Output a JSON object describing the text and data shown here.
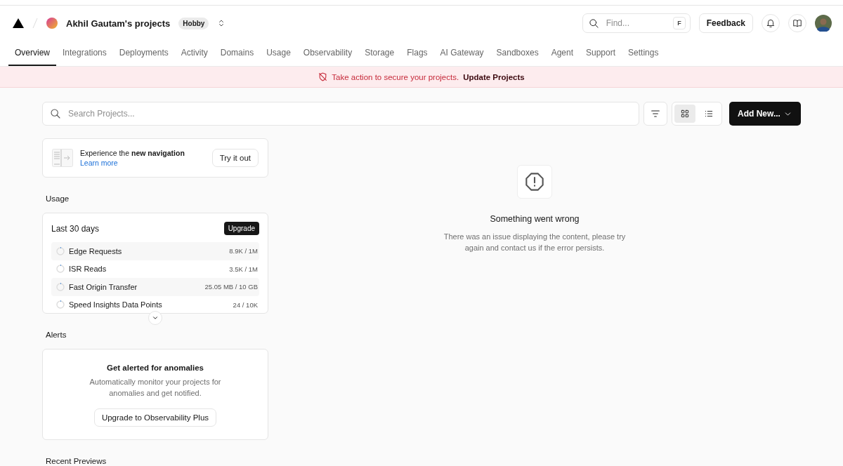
{
  "header": {
    "team": "Akhil Gautam's projects",
    "plan": "Hobby",
    "find_placeholder": "Find...",
    "find_key": "F",
    "feedback": "Feedback"
  },
  "tabs": [
    {
      "label": "Overview",
      "selected": true
    },
    {
      "label": "Integrations",
      "selected": false
    },
    {
      "label": "Deployments",
      "selected": false
    },
    {
      "label": "Activity",
      "selected": false
    },
    {
      "label": "Domains",
      "selected": false
    },
    {
      "label": "Usage",
      "selected": false
    },
    {
      "label": "Observability",
      "selected": false
    },
    {
      "label": "Storage",
      "selected": false
    },
    {
      "label": "Flags",
      "selected": false
    },
    {
      "label": "AI Gateway",
      "selected": false
    },
    {
      "label": "Sandboxes",
      "selected": false
    },
    {
      "label": "Agent",
      "selected": false
    },
    {
      "label": "Support",
      "selected": false
    },
    {
      "label": "Settings",
      "selected": false
    }
  ],
  "banner": {
    "message": "Take action to secure your projects.",
    "link": "Update Projects"
  },
  "toolbar": {
    "search_placeholder": "Search Projects...",
    "views": [
      {
        "kind": "grid",
        "selected": true
      },
      {
        "kind": "list",
        "selected": false
      }
    ],
    "add_new": "Add New..."
  },
  "nav_card": {
    "text": "Experience the **new navigation**",
    "link": "Learn more",
    "button": "Try it out"
  },
  "usage": {
    "title": "Usage",
    "period": "Last 30 days",
    "upgrade": "Upgrade",
    "items": [
      {
        "name": "Edge Requests",
        "value": "8.9K / 1M"
      },
      {
        "name": "ISR Reads",
        "value": "3.5K / 1M"
      },
      {
        "name": "Fast Origin Transfer",
        "value": "25.05 MB / 10 GB"
      },
      {
        "name": "Speed Insights Data Points",
        "value": "24 / 10K"
      }
    ]
  },
  "alerts": {
    "title": "Alerts",
    "heading": "Get alerted for anomalies",
    "body": "Automatically monitor your projects for anomalies and get notified.",
    "button": "Upgrade to Observability Plus"
  },
  "recent": {
    "title": "Recent Previews"
  },
  "error": {
    "title": "Something went wrong",
    "body": "There was an issue displaying the content, please try again and contact us if the error persists."
  }
}
